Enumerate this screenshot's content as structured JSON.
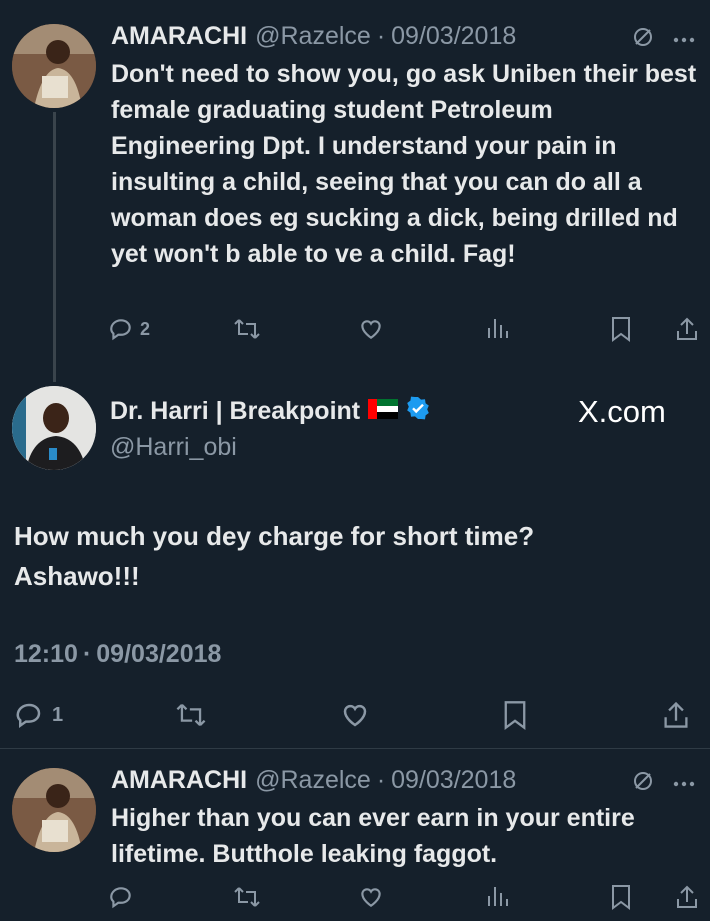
{
  "tweet1": {
    "name": "AMARACHI",
    "handle": "@Razelce",
    "date": "09/03/2018",
    "text": "Don't need to show you, go ask Uniben their best female graduating student Petroleum Engineering Dpt. I understand your pain in insulting a child, seeing that you can do all a woman does eg sucking a dick, being drilled nd yet won't b able to ve a child. Fag!",
    "replies": "2"
  },
  "main_tweet": {
    "name": "Dr. Harri | Breakpoint",
    "handle": "@Harri_obi",
    "watermark": "X.com",
    "text_line1": "How much you dey charge for short time?",
    "text_line2": "Ashawo!!!",
    "time": "12:10",
    "date": "09/03/2018",
    "replies": "1"
  },
  "tweet3": {
    "name": "AMARACHI",
    "handle": "@Razelce",
    "date": "09/03/2018",
    "text": "Higher than you can ever earn in your entire lifetime. Butthole leaking faggot."
  },
  "colors": {
    "background": "#15202b",
    "text": "#e7e9ea",
    "muted": "#8b98a5",
    "verified": "#1d9bf0"
  },
  "icons": [
    "reply-icon",
    "retweet-icon",
    "like-icon",
    "views-icon",
    "bookmark-icon",
    "share-icon",
    "grok-icon",
    "more-icon",
    "verified-badge-icon",
    "flag-icon"
  ]
}
